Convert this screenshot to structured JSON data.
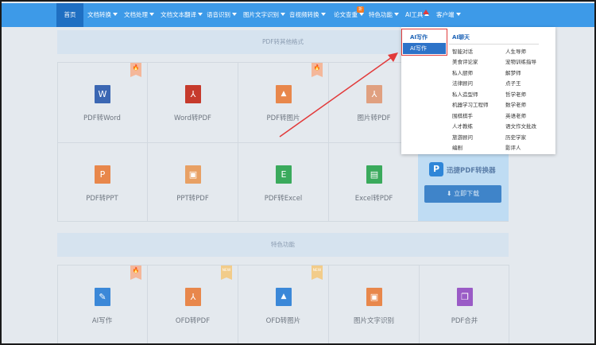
{
  "nav": {
    "items": [
      "首页",
      "文档转换",
      "文档处理",
      "文档文本翻译",
      "语音识别",
      "图片文字识别",
      "音视频转换",
      "论文查重",
      "特色功能",
      "AI工具",
      "客户端"
    ],
    "badge": "折",
    "accent": "#3d9ae8",
    "active_bg": "#1f6fc2"
  },
  "main": {
    "section1_title": "PDF转其他格式",
    "section2_title": "特色功能",
    "row1": [
      {
        "label": "PDF转Word",
        "icon": "word-icon",
        "glyph": "W",
        "color": "#3b67b3",
        "corner": "fire"
      },
      {
        "label": "Word转PDF",
        "icon": "pdf-icon",
        "glyph": "⅄",
        "color": "#c63a2c",
        "corner": ""
      },
      {
        "label": "PDF转图片",
        "icon": "image-icon",
        "glyph": "▲",
        "color": "#e8874b",
        "corner": "fire"
      },
      {
        "label": "图片转PDF",
        "icon": "pdf-icon",
        "glyph": "⅄",
        "color": "#e0a080",
        "corner": ""
      }
    ],
    "row2": [
      {
        "label": "PDF转PPT",
        "icon": "ppt-icon",
        "glyph": "P",
        "color": "#e8874b"
      },
      {
        "label": "PPT转PDF",
        "icon": "ppt-pdf-icon",
        "glyph": "▣",
        "color": "#e8a064"
      },
      {
        "label": "PDF转Excel",
        "icon": "excel-icon",
        "glyph": "E",
        "color": "#3aaa5c"
      },
      {
        "label": "Excel转PDF",
        "icon": "excel-pdf-icon",
        "glyph": "▤",
        "color": "#3aaa5c"
      }
    ],
    "row3": [
      {
        "label": "AI写作",
        "icon": "pen-icon",
        "glyph": "✎",
        "color": "#3b88d8",
        "corner": "fire"
      },
      {
        "label": "OFD转PDF",
        "icon": "pdf-icon",
        "glyph": "⅄",
        "color": "#e8874b",
        "corner": "new"
      },
      {
        "label": "OFD转图片",
        "icon": "image-icon",
        "glyph": "▲",
        "color": "#3b88d8",
        "corner": "new"
      },
      {
        "label": "图片文字识别",
        "icon": "ocr-icon",
        "glyph": "▣",
        "color": "#e8874b",
        "corner": ""
      },
      {
        "label": "PDF合并",
        "icon": "merge-icon",
        "glyph": "❐",
        "color": "#9a5bc6",
        "corner": ""
      }
    ],
    "new_badge": "NEW",
    "fire_badge": "🔥"
  },
  "promo": {
    "logo": "P",
    "title": "迅捷PDF转换器",
    "button": "⬇ 立即下载"
  },
  "dropdown": {
    "left_header": "AI写作",
    "left_selected": "AI写作",
    "right_header": "AI聊天",
    "col1": [
      "智能对话",
      "美食评论家",
      "私人厨师",
      "法律顾问",
      "私人造型师",
      "机器学习工程师",
      "围棋棋手",
      "人才教练",
      "旅游顾问",
      "编剧"
    ],
    "col2": [
      "人生导师",
      "宠物训练指导",
      "解梦师",
      "点子王",
      "哲学老师",
      "数学老师",
      "英语老师",
      "语文作文批改",
      "历史学家",
      "影评人"
    ]
  }
}
